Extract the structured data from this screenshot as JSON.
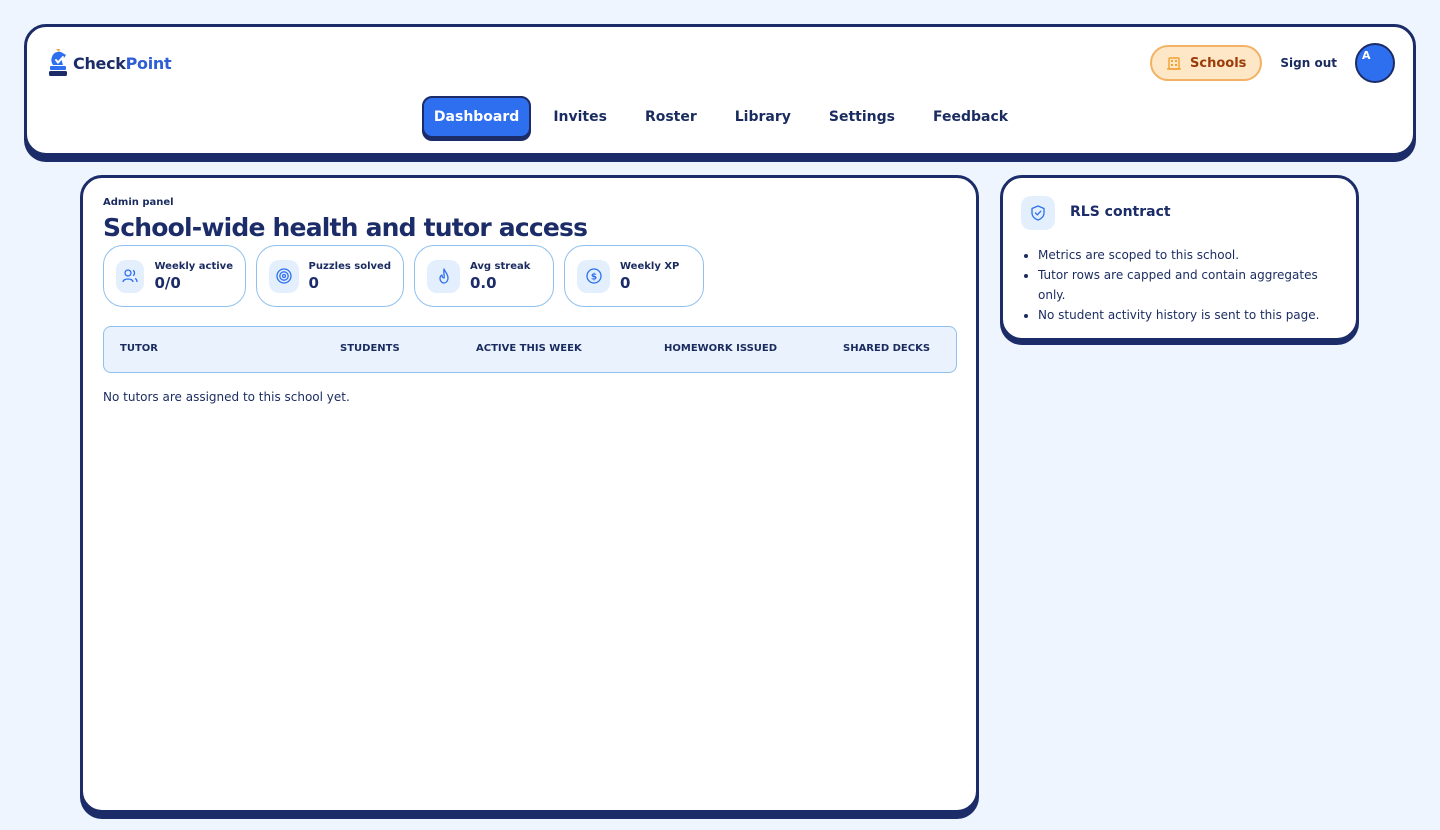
{
  "header": {
    "logo_text_a": "Check",
    "logo_text_b": "Point",
    "schools_label": "Schools",
    "signout_label": "Sign out",
    "avatar_initial": "A"
  },
  "nav": {
    "items": [
      "Dashboard",
      "Invites",
      "Roster",
      "Library",
      "Settings",
      "Feedback"
    ],
    "active": "Dashboard"
  },
  "main": {
    "kicker": "Admin panel",
    "title": "School-wide health and tutor access",
    "stats": [
      {
        "icon": "users-icon",
        "label": "Weekly active",
        "value": "0/0"
      },
      {
        "icon": "target-icon",
        "label": "Puzzles solved",
        "value": "0"
      },
      {
        "icon": "flame-icon",
        "label": "Avg streak",
        "value": "0.0"
      },
      {
        "icon": "dollar-icon",
        "label": "Weekly XP",
        "value": "0"
      }
    ],
    "table": {
      "columns": [
        "TUTOR",
        "STUDENTS",
        "ACTIVE THIS WEEK",
        "HOMEWORK ISSUED",
        "SHARED DECKS"
      ],
      "empty_message": "No tutors are assigned to this school yet."
    }
  },
  "side": {
    "icon": "shield-check-icon",
    "title": "RLS contract",
    "items": [
      "Metrics are scoped to this school.",
      "Tutor rows are capped and contain aggregates only.",
      "No student activity history is sent to this page."
    ]
  },
  "colors": {
    "accent": "#2e6ff0",
    "navy": "#1b2c68",
    "page_bg": "#eef5fe",
    "schools_bg": "#fde7c6",
    "schools_border": "#f2b264"
  }
}
